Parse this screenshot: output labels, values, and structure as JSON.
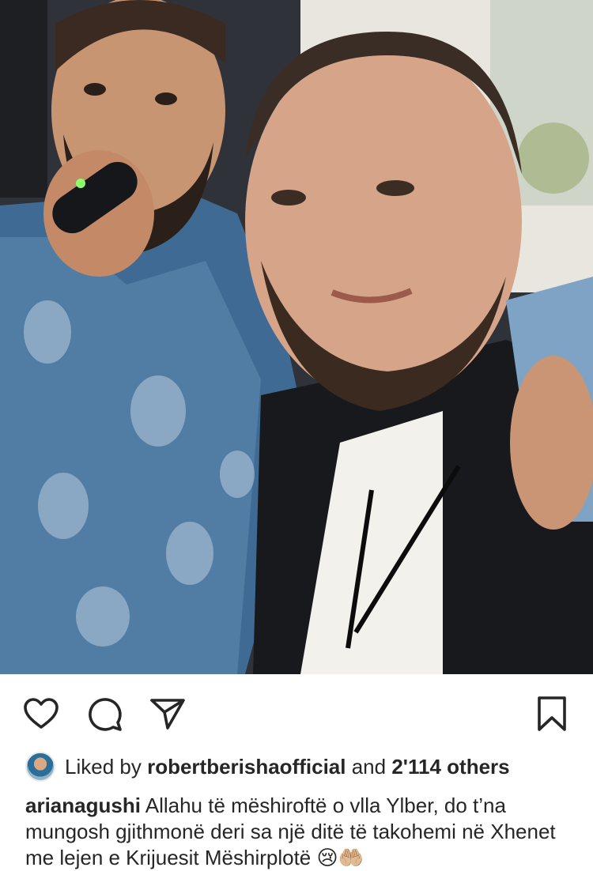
{
  "post": {
    "image_alt": "Selfie of two men; one holding a microphone",
    "actions": {
      "like_icon": "heart-outline-icon",
      "comment_icon": "comment-bubble-icon",
      "share_icon": "paper-plane-icon",
      "save_icon": "bookmark-outline-icon"
    },
    "likes": {
      "prefix": "Liked by",
      "liked_by_user": "robertberishaofficial",
      "connector": "and",
      "others": "2'114 others"
    },
    "caption": {
      "username": "arianagushi",
      "text": "Allahu të mëshiroftë o vlla Ylber, do t’na mungosh gjithmonë deri sa një ditë të takohemi në Xhenet me lejen e Krijuesit Mëshirplotë 😢🤲🏼"
    }
  },
  "colors": {
    "text": "#262626",
    "background": "#ffffff"
  }
}
